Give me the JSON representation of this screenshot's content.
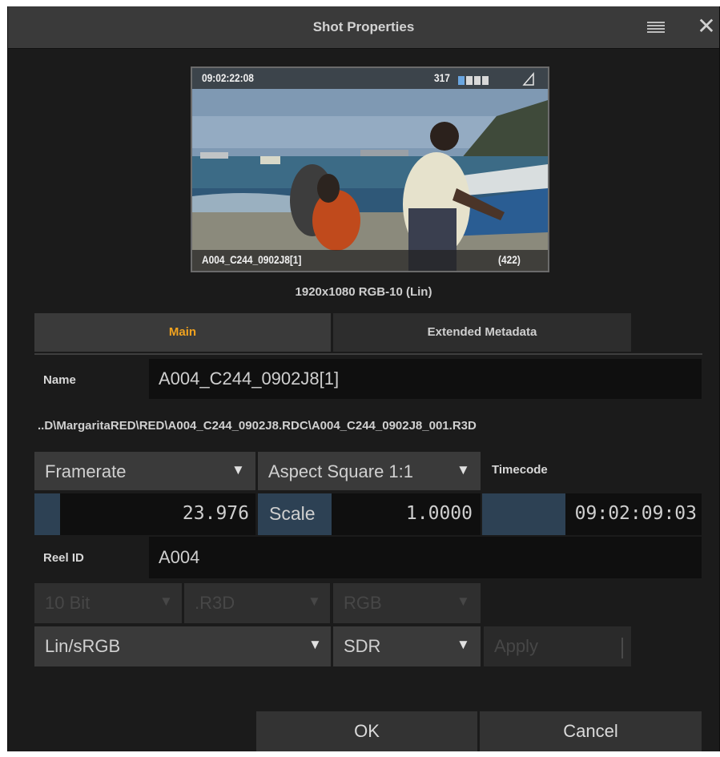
{
  "window": {
    "title": "Shot Properties"
  },
  "preview": {
    "timecode": "09:02:22:08",
    "frame_count": "317",
    "clip_name": "A004_C244_0902J8[1]",
    "frame_total": "(422)",
    "resolution": "1920x1080 RGB-10 (Lin)"
  },
  "tabs": {
    "main": "Main",
    "extended": "Extended Metadata"
  },
  "fields": {
    "name_label": "Name",
    "name_value": "A004_C244_0902J8[1]",
    "path": "..D\\MargaritaRED\\RED\\A004_C244_0902J8.RDC\\A004_C244_0902J8_001.R3D",
    "framerate_label": "Framerate",
    "aspect_label": "Aspect Square 1:1",
    "timecode_label": "Timecode",
    "framerate_value": "23.976",
    "scale_label": "Scale",
    "scale_value": "1.0000",
    "timecode_value": "09:02:09:03",
    "reel_label": "Reel ID",
    "reel_value": "A004",
    "bit_depth": "10 Bit",
    "format": ".R3D",
    "color_model": "RGB",
    "colorspace": "Lin/sRGB",
    "range": "SDR",
    "apply_label": "Apply"
  },
  "buttons": {
    "ok": "OK",
    "cancel": "Cancel"
  },
  "icons": {
    "menu": "menu-icon",
    "close": "close-icon",
    "arrow": "dropdown-arrow-icon"
  },
  "colors": {
    "accent": "#f0a21f",
    "background": "#1b1b1b",
    "titlebar": "#3a3a3a"
  }
}
